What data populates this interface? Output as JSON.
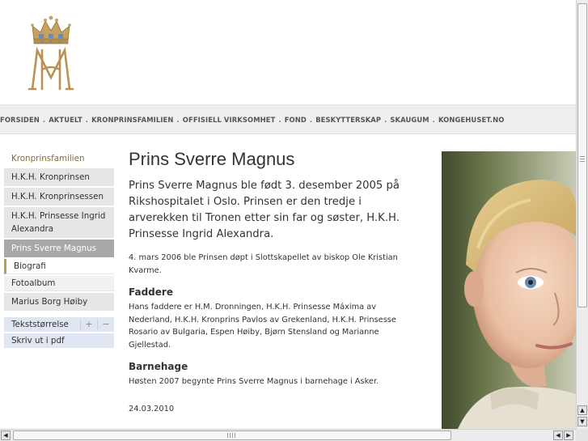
{
  "nav": {
    "items": [
      "FORSIDEN",
      "AKTUELT",
      "KRONPRINSFAMILIEN",
      "OFFISIELL VIRKSOMHET",
      "FOND",
      "BESKYTTERSKAP",
      "SKAUGUM",
      "KONGEHUSET.NO"
    ],
    "separator": "."
  },
  "sidebar": {
    "heading": "Kronprinsfamilien",
    "items": [
      {
        "label": "H.K.H. Kronprinsen"
      },
      {
        "label": "H.K.H. Kronprinsessen"
      },
      {
        "label": "H.K.H. Prinsesse Ingrid Alexandra"
      },
      {
        "label": "Prins Sverre Magnus",
        "selected": true
      }
    ],
    "subitems": [
      "Biografi",
      "Fotoalbum"
    ],
    "extra_item": "Marius Borg Høiby"
  },
  "tools": {
    "text_size_label": "Tekststørrelse",
    "increase": "+",
    "decrease": "−",
    "print_label": "Skriv ut i pdf"
  },
  "article": {
    "title": "Prins Sverre Magnus",
    "lead": "Prins Sverre Magnus ble født 3. desember 2005 på Rikshospitalet i Oslo. Prinsen er den tredje i arverekken til Tronen etter sin far og søster, H.K.H. Prinsesse Ingrid Alexandra.",
    "para1": "4. mars 2006 ble Prinsen døpt i Slottskapellet av biskop Ole Kristian Kvarme.",
    "section1_heading": "Faddere",
    "section1_text": "Hans faddere er H.M. Dronningen, H.K.H. Prinsesse Máxima av Nederland, H.K.H. Kronprins Pavlos av Grekenland, H.K.H. Prinsesse Rosario av Bulgaria, Espen Høiby, Bjørn Stensland og Marianne Gjellestad.",
    "section2_heading": "Barnehage",
    "section2_text": "Høsten 2007 begynte Prins Sverre Magnus i barnehage i Asker.",
    "date": "24.03.2010"
  },
  "colors": {
    "accent_gold": "#c09a5b",
    "nav_bg": "#efefef",
    "sidebar_bg": "#e6e6e6",
    "selected_bg": "#a8a8a8",
    "tools_bg": "#dfe6f2"
  },
  "icons": {
    "logo": "royal-crown-monogram",
    "scroll_up": "up-arrow-icon",
    "scroll_down": "down-arrow-icon",
    "scroll_left": "left-arrow-icon",
    "scroll_right": "right-arrow-icon"
  }
}
